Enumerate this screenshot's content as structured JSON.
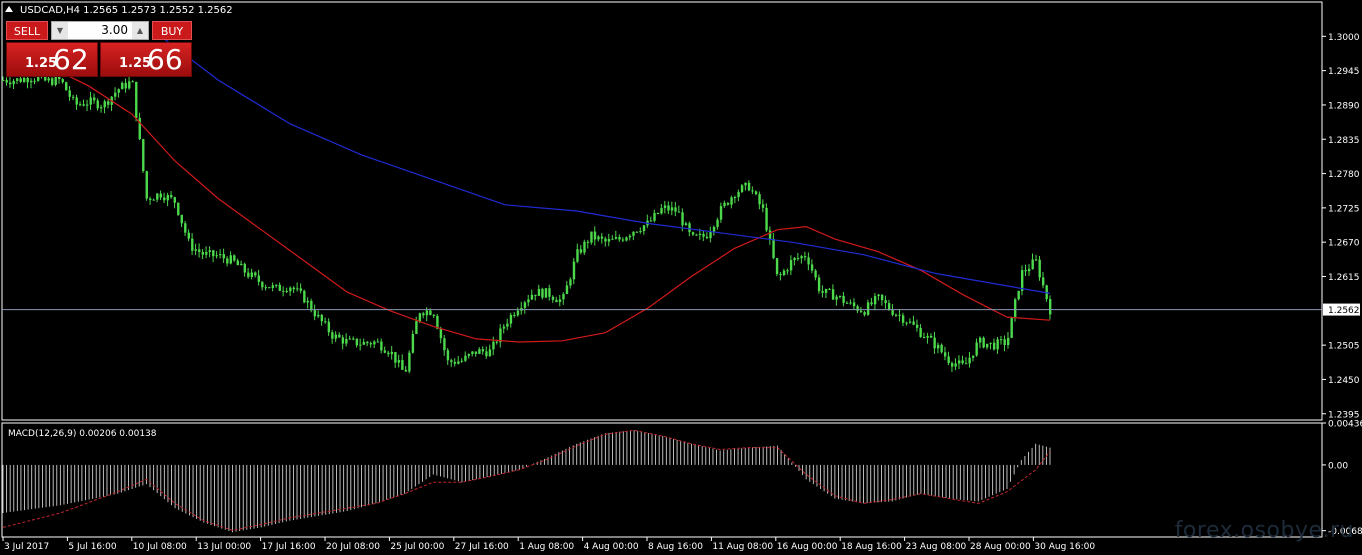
{
  "header": {
    "symbol_info": "USDCAD,H4  1.2565 1.2573 1.2552 1.2562"
  },
  "trade_panel": {
    "sell_label": "SELL",
    "buy_label": "BUY",
    "lot": "3.00",
    "sell_price_small": "1.25",
    "sell_price_big": "62",
    "buy_price_small": "1.25",
    "buy_price_big": "66"
  },
  "watermark": "forex.osobye.ru",
  "colors": {
    "background": "#000000",
    "grid": "#ffffff",
    "candle": "#4cd94c",
    "ma_fast": "#d11a1a",
    "ma_slow": "#1f2bd4",
    "price_line": "#8a96b3",
    "macd_hist": "#d0d0d0",
    "macd_signal": "#c2262e",
    "sell_button": "#c9191a",
    "text": "#ffffff"
  },
  "chart_data": [
    {
      "type": "candlestick",
      "symbol": "USDCAD",
      "timeframe": "H4",
      "current_price": 1.2562,
      "ylim": [
        1.2385,
        1.3055
      ],
      "y_ticks": [
        1.3,
        1.2945,
        1.289,
        1.2835,
        1.278,
        1.2725,
        1.267,
        1.2615,
        1.2562,
        1.2505,
        1.245,
        1.2395
      ],
      "y_tick_labels": [
        "1.3000",
        "1.2945",
        "1.2890",
        "1.2835",
        "1.2780",
        "1.2725",
        "1.2670",
        "1.2615",
        "1.2562",
        "1.2505",
        "1.2450",
        "1.2395"
      ],
      "x_labels": [
        "3 Jul 2017",
        "5 Jul 16:00",
        "10 Jul 08:00",
        "13 Jul 00:00",
        "17 Jul 16:00",
        "20 Jul 08:00",
        "25 Jul 00:00",
        "27 Jul 16:00",
        "1 Aug 08:00",
        "4 Aug 00:00",
        "8 Aug 16:00",
        "11 Aug 08:00",
        "16 Aug 00:00",
        "18 Aug 16:00",
        "23 Aug 08:00",
        "28 Aug 00:00",
        "30 Aug 16:00"
      ],
      "close_path": [
        [
          0,
          1.293
        ],
        [
          1,
          1.293
        ],
        [
          2,
          1.2935
        ],
        [
          3,
          1.2928
        ],
        [
          4,
          1.293
        ],
        [
          5,
          1.289
        ],
        [
          6,
          1.2895
        ],
        [
          7,
          1.289
        ],
        [
          8,
          1.2915
        ],
        [
          9,
          1.2928
        ],
        [
          10,
          1.274
        ],
        [
          11,
          1.2748
        ],
        [
          12,
          1.2735
        ],
        [
          13,
          1.2665
        ],
        [
          14,
          1.265
        ],
        [
          15,
          1.2648
        ],
        [
          16,
          1.264
        ],
        [
          17,
          1.262
        ],
        [
          18,
          1.2605
        ],
        [
          19,
          1.2595
        ],
        [
          20,
          1.26
        ],
        [
          21,
          1.258
        ],
        [
          22,
          1.2548
        ],
        [
          23,
          1.252
        ],
        [
          24,
          1.251
        ],
        [
          25,
          1.2508
        ],
        [
          26,
          1.251
        ],
        [
          27,
          1.2495
        ],
        [
          28,
          1.2458
        ],
        [
          29,
          1.256
        ],
        [
          30,
          1.256
        ],
        [
          31,
          1.2478
        ],
        [
          32,
          1.248
        ],
        [
          33,
          1.2495
        ],
        [
          34,
          1.2495
        ],
        [
          35,
          1.254
        ],
        [
          36,
          1.257
        ],
        [
          37,
          1.259
        ],
        [
          38,
          1.2588
        ],
        [
          39,
          1.2575
        ],
        [
          40,
          1.265
        ],
        [
          41,
          1.268
        ],
        [
          42,
          1.267
        ],
        [
          43,
          1.2675
        ],
        [
          44,
          1.269
        ],
        [
          45,
          1.27
        ],
        [
          46,
          1.2725
        ],
        [
          47,
          1.272
        ],
        [
          48,
          1.2675
        ],
        [
          49,
          1.268
        ],
        [
          50,
          1.272
        ],
        [
          51,
          1.275
        ],
        [
          52,
          1.276
        ],
        [
          53,
          1.272
        ],
        [
          54,
          1.261
        ],
        [
          55,
          1.264
        ],
        [
          56,
          1.265
        ],
        [
          57,
          1.259
        ],
        [
          58,
          1.2585
        ],
        [
          59,
          1.257
        ],
        [
          60,
          1.256
        ],
        [
          61,
          1.258
        ],
        [
          62,
          1.256
        ],
        [
          63,
          1.2545
        ],
        [
          64,
          1.2525
        ],
        [
          65,
          1.2505
        ],
        [
          66,
          1.248
        ],
        [
          67,
          1.247
        ],
        [
          68,
          1.251
        ],
        [
          69,
          1.2505
        ],
        [
          70,
          1.251
        ],
        [
          71,
          1.262
        ],
        [
          72,
          1.264
        ],
        [
          73,
          1.2562
        ]
      ],
      "series": [
        {
          "name": "MA (red)",
          "values": [
            [
              2.5,
              1.296
            ],
            [
              6,
              1.292
            ],
            [
              9,
              1.2875
            ],
            [
              12,
              1.28
            ],
            [
              15,
              1.274
            ],
            [
              18,
              1.269
            ],
            [
              21,
              1.264
            ],
            [
              24,
              1.259
            ],
            [
              27,
              1.256
            ],
            [
              30,
              1.2535
            ],
            [
              33,
              1.2515
            ],
            [
              36,
              1.251
            ],
            [
              39,
              1.2512
            ],
            [
              42,
              1.2525
            ],
            [
              45,
              1.2565
            ],
            [
              48,
              1.2615
            ],
            [
              51,
              1.266
            ],
            [
              54,
              1.269
            ],
            [
              56,
              1.2695
            ],
            [
              58,
              1.2675
            ],
            [
              61,
              1.2655
            ],
            [
              64,
              1.2625
            ],
            [
              67,
              1.2585
            ],
            [
              70,
              1.255
            ],
            [
              73,
              1.2545
            ]
          ]
        },
        {
          "name": "MA (blue)",
          "values": [
            [
              11,
              1.3
            ],
            [
              15,
              1.293
            ],
            [
              20,
              1.286
            ],
            [
              25,
              1.281
            ],
            [
              30,
              1.277
            ],
            [
              35,
              1.273
            ],
            [
              40,
              1.272
            ],
            [
              45,
              1.27
            ],
            [
              50,
              1.2685
            ],
            [
              55,
              1.267
            ],
            [
              60,
              1.265
            ],
            [
              65,
              1.262
            ],
            [
              70,
              1.26
            ],
            [
              73,
              1.2588
            ]
          ]
        }
      ]
    },
    {
      "type": "histogram",
      "title": "MACD(12,26,9) 0.00206 0.00138",
      "ylim": [
        -0.0075,
        0.00436
      ],
      "y_ticks": [
        0.00436,
        0.0,
        -0.00684
      ],
      "y_tick_labels": [
        "0.00436",
        "0.00",
        "-0.00684"
      ],
      "histogram": [
        [
          0,
          -0.005
        ],
        [
          4,
          -0.0042
        ],
        [
          8,
          -0.003
        ],
        [
          10,
          -0.002
        ],
        [
          12,
          -0.0045
        ],
        [
          14,
          -0.006
        ],
        [
          16,
          -0.007
        ],
        [
          18,
          -0.0065
        ],
        [
          20,
          -0.0058
        ],
        [
          22,
          -0.0053
        ],
        [
          24,
          -0.0048
        ],
        [
          26,
          -0.004
        ],
        [
          28,
          -0.003
        ],
        [
          30,
          -0.001
        ],
        [
          32,
          -0.0018
        ],
        [
          34,
          -0.0012
        ],
        [
          36,
          -0.0005
        ],
        [
          38,
          0.0008
        ],
        [
          40,
          0.0022
        ],
        [
          42,
          0.0033
        ],
        [
          44,
          0.0036
        ],
        [
          46,
          0.003
        ],
        [
          48,
          0.0022
        ],
        [
          50,
          0.0015
        ],
        [
          52,
          0.0018
        ],
        [
          54,
          0.002
        ],
        [
          56,
          -0.0015
        ],
        [
          58,
          -0.0035
        ],
        [
          60,
          -0.004
        ],
        [
          62,
          -0.0038
        ],
        [
          64,
          -0.003
        ],
        [
          66,
          -0.0035
        ],
        [
          68,
          -0.0038
        ],
        [
          70,
          -0.0025
        ],
        [
          71,
          0.0005
        ],
        [
          72,
          0.0022
        ],
        [
          73,
          0.0018
        ]
      ],
      "signal": [
        [
          0,
          -0.0065
        ],
        [
          4,
          -0.005
        ],
        [
          8,
          -0.0028
        ],
        [
          10,
          -0.0015
        ],
        [
          12,
          -0.004
        ],
        [
          14,
          -0.0058
        ],
        [
          16,
          -0.0068
        ],
        [
          18,
          -0.0062
        ],
        [
          20,
          -0.0055
        ],
        [
          22,
          -0.005
        ],
        [
          24,
          -0.0045
        ],
        [
          26,
          -0.004
        ],
        [
          28,
          -0.003
        ],
        [
          30,
          -0.0018
        ],
        [
          32,
          -0.0018
        ],
        [
          34,
          -0.0012
        ],
        [
          36,
          -0.0005
        ],
        [
          38,
          0.0006
        ],
        [
          40,
          0.002
        ],
        [
          42,
          0.0032
        ],
        [
          44,
          0.0036
        ],
        [
          46,
          0.003
        ],
        [
          48,
          0.0022
        ],
        [
          50,
          0.0016
        ],
        [
          52,
          0.0018
        ],
        [
          54,
          0.0018
        ],
        [
          56,
          -0.001
        ],
        [
          58,
          -0.0032
        ],
        [
          60,
          -0.004
        ],
        [
          62,
          -0.0036
        ],
        [
          64,
          -0.003
        ],
        [
          66,
          -0.0035
        ],
        [
          68,
          -0.004
        ],
        [
          70,
          -0.0028
        ],
        [
          72,
          -0.0005
        ],
        [
          73,
          0.0014
        ]
      ]
    }
  ]
}
